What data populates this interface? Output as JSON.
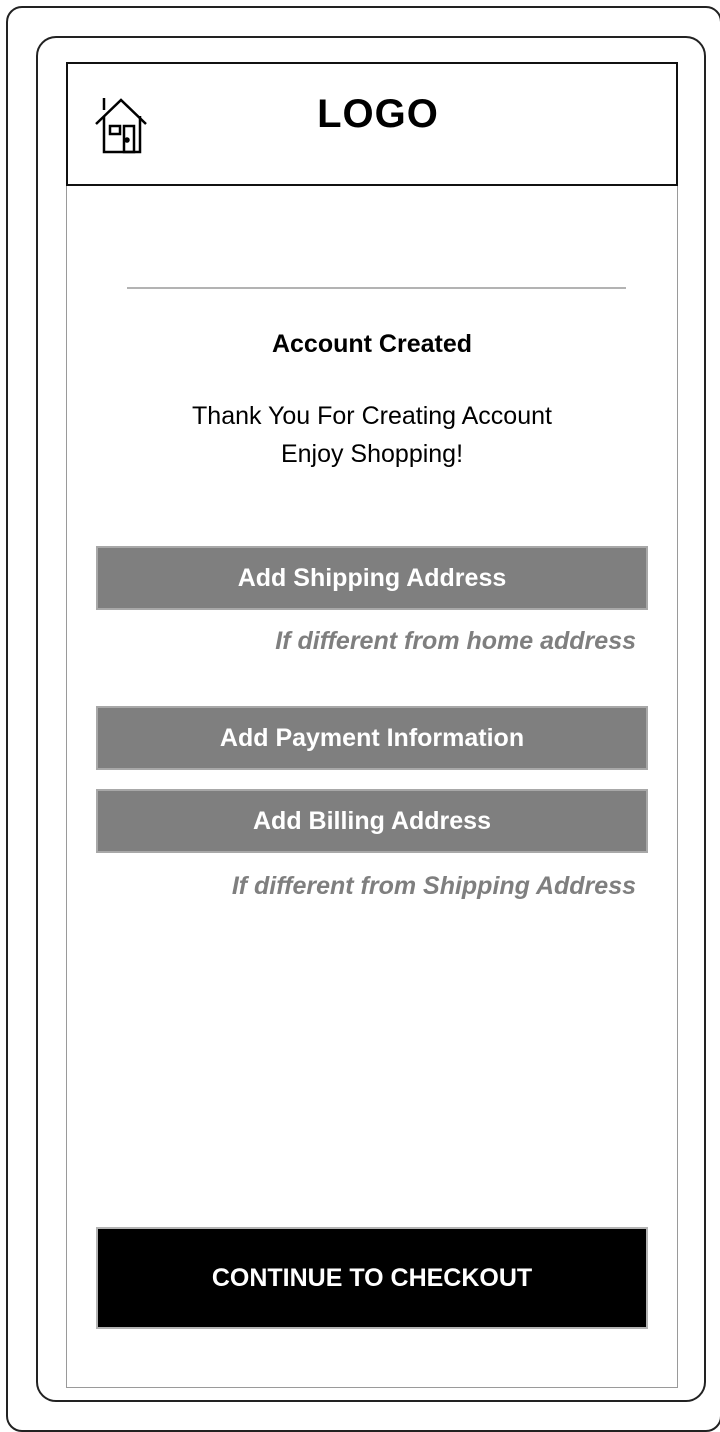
{
  "header": {
    "logo": "LOGO",
    "home_icon": "home-icon"
  },
  "confirmation": {
    "title": "Account Created",
    "message_line1": "Thank You For Creating Account",
    "message_line2": "Enjoy Shopping!"
  },
  "actions": {
    "shipping_label": "Add Shipping Address",
    "shipping_hint": "If different from home address",
    "payment_label": "Add Payment Information",
    "billing_label": "Add Billing Address",
    "billing_hint": "If different from Shipping Address"
  },
  "checkout": {
    "label": "CONTINUE TO CHECKOUT"
  },
  "colors": {
    "action_button": "#7f7f7f",
    "checkout_button": "#000000",
    "hint_text": "#7f7f7f"
  }
}
